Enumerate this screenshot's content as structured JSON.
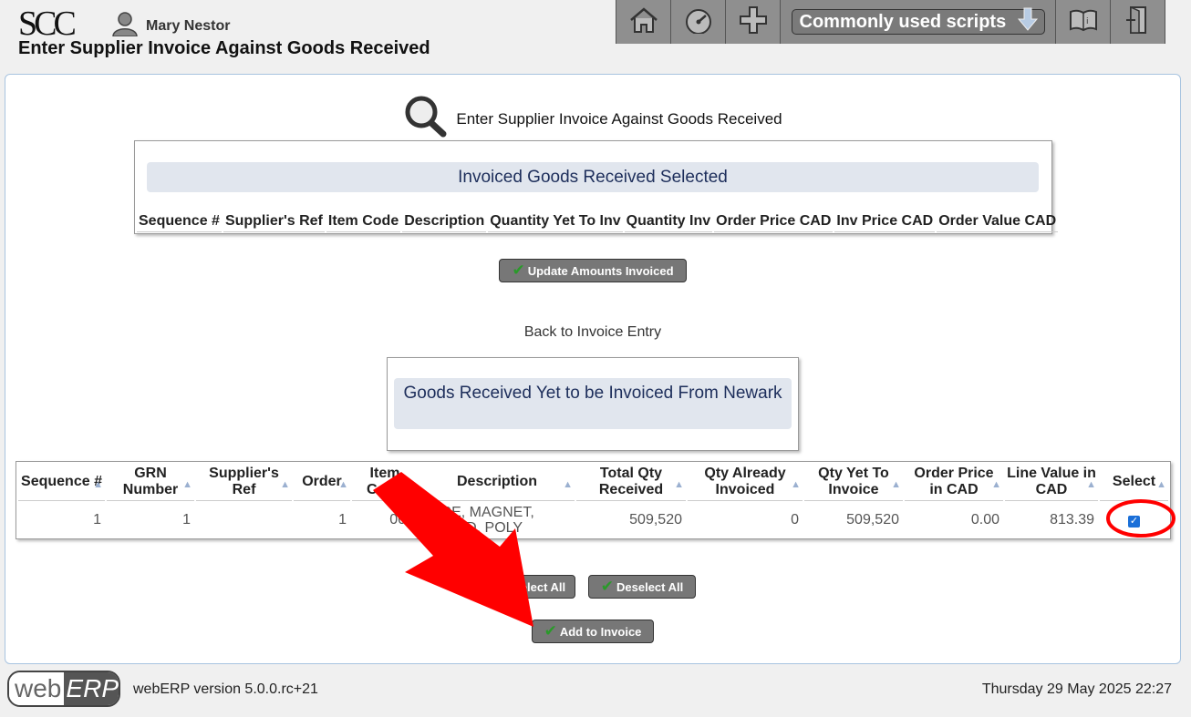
{
  "header": {
    "logo": "SCC",
    "user_name": "Mary Nestor",
    "page_title": "Enter Supplier Invoice Against Goods Received"
  },
  "toolbar": {
    "scripts_label": "Commonly used scripts",
    "icons": [
      "home-icon",
      "dashboard-icon",
      "plus-icon",
      "manual-icon",
      "logout-icon"
    ]
  },
  "main": {
    "section_title": "Enter Supplier Invoice Against Goods Received",
    "selected_caption": "Invoiced Goods Received Selected",
    "selected_headers": [
      "Sequence #",
      "Supplier's Ref",
      "Item Code",
      "Description",
      "Quantity Yet To Inv",
      "Quantity Inv",
      "Order Price CAD",
      "Inv Price CAD",
      "Order Value CAD"
    ],
    "update_button": "Update Amounts Invoiced",
    "back_link": "Back to Invoice Entry",
    "pending_caption": "Goods Received Yet to be Invoiced From Newark",
    "grn_headers": [
      "Sequence #",
      "GRN Number",
      "Supplier's Ref",
      "Order",
      "Item Code",
      "Description",
      "Total Qty Received",
      "Qty Already Invoiced",
      "Qty Yet To Invoice",
      "Order Price in CAD",
      "Line Value in CAD",
      "Select"
    ],
    "grn_rows": [
      {
        "sequence": "1",
        "grn": "1",
        "supplier_ref": "",
        "order": "1",
        "item_code": "000",
        "description": "WIRE, MAGNET, ROUND, POLY",
        "total_qty": "509,520",
        "qty_invoiced": "0",
        "qty_yet": "509,520",
        "order_price": "0.00",
        "line_value": "813.39",
        "selected": true
      }
    ],
    "select_all": "Select All",
    "deselect_all": "Deselect All",
    "add_to_invoice": "Add to Invoice"
  },
  "footer": {
    "logo_left": "web",
    "logo_right": "ERP",
    "version": "webERP version 5.0.0.rc+21",
    "datetime": "Thursday 29 May 2025 22:27"
  },
  "colors": {
    "caption_bg": "#e1e6ee",
    "caption_text": "#1d2e5b",
    "button_bg": "#777777",
    "annotation": "#ff0000"
  }
}
